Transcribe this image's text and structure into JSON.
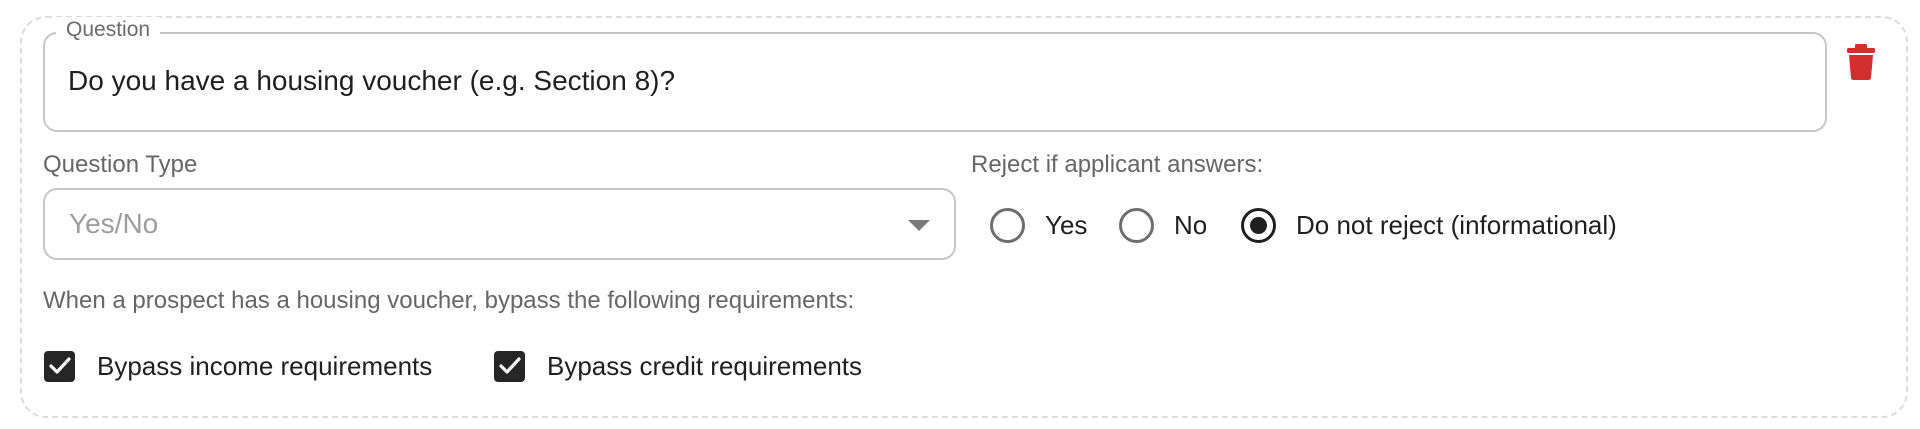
{
  "question": {
    "legend": "Question",
    "value": "Do you have a housing voucher (e.g. Section 8)?"
  },
  "delete": {
    "icon": "trash-icon",
    "color": "#d32f2f"
  },
  "question_type": {
    "label": "Question Type",
    "selected": "Yes/No"
  },
  "reject": {
    "label": "Reject if applicant answers:",
    "options": [
      {
        "label": "Yes",
        "checked": false
      },
      {
        "label": "No",
        "checked": false
      },
      {
        "label": "Do not reject (informational)",
        "checked": true
      }
    ]
  },
  "bypass": {
    "prompt": "When a prospect has a housing voucher, bypass the following requirements:",
    "options": [
      {
        "label": "Bypass income requirements",
        "checked": true
      },
      {
        "label": "Bypass credit requirements",
        "checked": true
      }
    ]
  }
}
